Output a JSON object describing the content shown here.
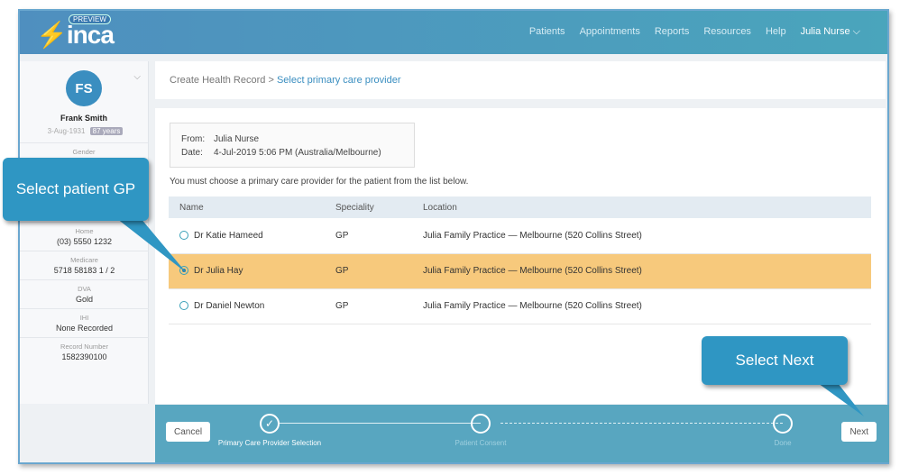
{
  "header": {
    "logo": "inca",
    "badge": "PREVIEW",
    "nav": [
      "Patients",
      "Appointments",
      "Reports",
      "Resources",
      "Help"
    ],
    "user": "Julia Nurse"
  },
  "patient": {
    "initials": "FS",
    "name": "Frank Smith",
    "dob": "3-Aug-1931",
    "age": "87 years",
    "fields": [
      {
        "label": "Gender",
        "value": ""
      },
      {
        "label": "Home",
        "value": "(03) 5550 1232"
      },
      {
        "label": "Medicare",
        "value": "5718 58183 1 / 2"
      },
      {
        "label": "DVA",
        "value": "Gold"
      },
      {
        "label": "IHI",
        "value": "None Recorded"
      },
      {
        "label": "Record Number",
        "value": "1582390100"
      }
    ]
  },
  "breadcrumb": {
    "root": "Create Health Record",
    "sep": ">",
    "current": "Select primary care provider"
  },
  "meta": {
    "from_label": "From:",
    "from": "Julia Nurse",
    "date_label": "Date:",
    "date": "4-Jul-2019 5:06 PM (Australia/Melbourne)"
  },
  "message": "You must choose a primary care provider for the patient from the list below.",
  "table": {
    "headers": [
      "Name",
      "Speciality",
      "Location"
    ],
    "rows": [
      {
        "name": "Dr Katie Hameed",
        "speciality": "GP",
        "location": "Julia Family Practice — Melbourne (520 Collins Street)",
        "selected": false
      },
      {
        "name": "Dr Julia Hay",
        "speciality": "GP",
        "location": "Julia Family Practice — Melbourne (520 Collins Street)",
        "selected": true
      },
      {
        "name": "Dr Daniel Newton",
        "speciality": "GP",
        "location": "Julia Family Practice — Melbourne (520 Collins Street)",
        "selected": false
      }
    ]
  },
  "footer": {
    "cancel": "Cancel",
    "next": "Next",
    "steps": [
      "Primary Care Provider Selection",
      "Patient Consent",
      "Done"
    ],
    "check": "✓"
  },
  "callouts": {
    "gp": "Select patient GP",
    "next": "Select Next"
  }
}
